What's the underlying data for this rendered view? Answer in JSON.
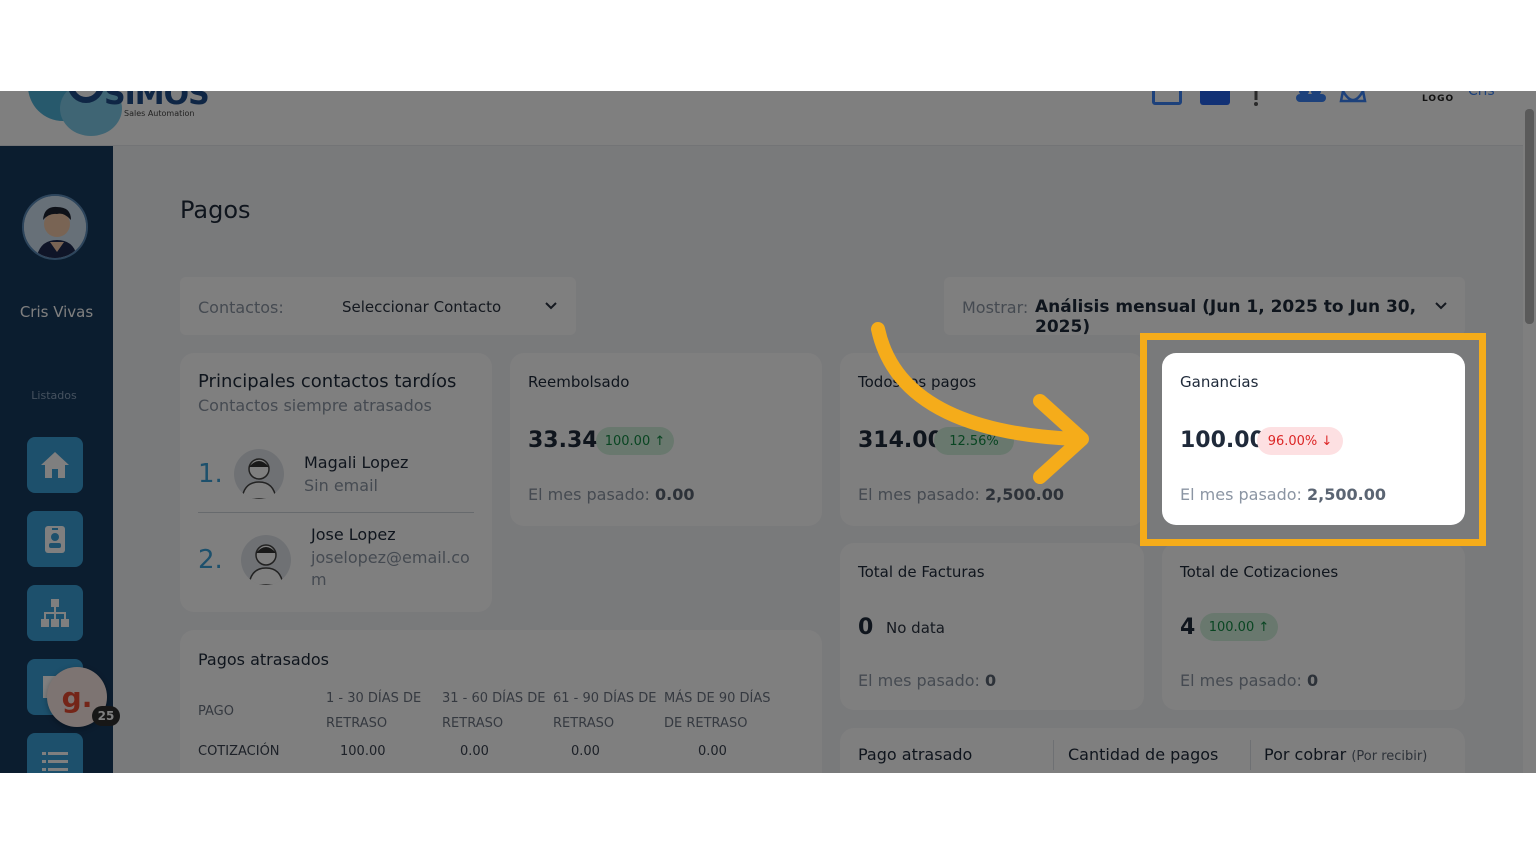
{
  "header": {
    "logo_text": "SIMOS",
    "logo_subtitle": "Sales Automation",
    "user_logo_text": "LOGO",
    "user_name": "Cris",
    "icons": [
      "calendar-icon",
      "linkedin-icon",
      "help-icon",
      "users-icon",
      "bell-icon"
    ]
  },
  "sidebar": {
    "user_name": "Cris Vivas",
    "section_label": "Listados",
    "items": [
      "home-icon",
      "contacts-icon",
      "org-chart-icon",
      "documents-icon",
      "list-icon"
    ],
    "widget_letter": "g.",
    "widget_count": "25"
  },
  "page": {
    "title": "Pagos"
  },
  "filters": {
    "contacts_label": "Contactos:",
    "contacts_value": "Seleccionar Contacto",
    "show_label": "Mostrar:",
    "show_value": "Análisis mensual (Jun 1, 2025 to Jun 30, 2025)"
  },
  "late_contacts": {
    "title": "Principales contactos tardíos",
    "subtitle": "Contactos siempre atrasados",
    "people": [
      {
        "rank": "1.",
        "name": "Magali Lopez",
        "email": "Sin email"
      },
      {
        "rank": "2.",
        "name": "Jose Lopez",
        "email": "joselopez@email.com"
      }
    ]
  },
  "metrics": {
    "reembolsado": {
      "title": "Reembolsado",
      "value": "33.34",
      "change": "100.00 ↑",
      "prev_label": "El mes pasado:",
      "prev_value": "0.00"
    },
    "todos_pagos": {
      "title": "Todos los pagos",
      "value": "314.00",
      "change": "12.56%",
      "prev_label": "El mes pasado:",
      "prev_value": "2,500.00"
    },
    "ganancias": {
      "title": "Ganancias",
      "value": "100.00",
      "change": "96.00% ↓",
      "prev_label": "El mes pasado:",
      "prev_value": "2,500.00"
    },
    "facturas": {
      "title": "Total de Facturas",
      "value": "0",
      "change": "No data",
      "prev_label": "El mes pasado:",
      "prev_value": "0"
    },
    "cotizaciones": {
      "title": "Total de Cotizaciones",
      "value": "4",
      "change": "100.00 ↑",
      "prev_label": "El mes pasado:",
      "prev_value": "0"
    }
  },
  "late_payments": {
    "title": "Pagos atrasados",
    "headers": [
      "PAGO",
      "1 - 30 DÍAS DE RETRASO",
      "31 - 60 DÍAS DE RETRASO",
      "61 - 90 DÍAS DE RETRASO",
      "MÁS DE 90 DÍAS DE RETRASO"
    ],
    "rows": [
      [
        "COTIZACIÓN",
        "100.00",
        "0.00",
        "0.00",
        "0.00"
      ]
    ]
  },
  "summary": {
    "col1": "Pago atrasado",
    "col2": "Cantidad de pagos",
    "col3": "Por cobrar",
    "col3_note": "(Por recibir)"
  },
  "colors": {
    "sidebar": "#173a5e",
    "nav_button": "#3aa0d8",
    "highlight": "#f5ac1a",
    "positive": "#138a44",
    "negative": "#dc2626"
  }
}
